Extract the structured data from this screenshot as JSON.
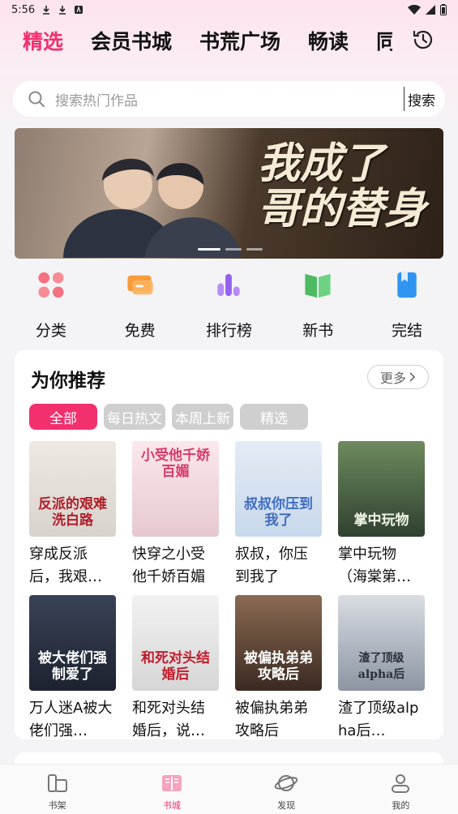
{
  "status_bar": {
    "time": "5:56"
  },
  "tabs": [
    {
      "label": "精选",
      "active": true
    },
    {
      "label": "会员书城"
    },
    {
      "label": "书荒广场"
    },
    {
      "label": "畅读"
    },
    {
      "label": "同"
    }
  ],
  "search": {
    "placeholder": "搜索热门作品",
    "button": "搜索"
  },
  "banner": {
    "title_line1": "我成了",
    "title_line2": "哥的替身"
  },
  "categories": [
    {
      "label": "分类",
      "icon": "clover-icon",
      "color": "#f4727f"
    },
    {
      "label": "免费",
      "icon": "ticket-icon",
      "color": "#f99b3c"
    },
    {
      "label": "排行榜",
      "icon": "bar-chart-icon",
      "color": "#a070f0"
    },
    {
      "label": "新书",
      "icon": "open-book-icon",
      "color": "#4cbb62"
    },
    {
      "label": "完结",
      "icon": "bookmark-icon",
      "color": "#2f95f0"
    }
  ],
  "recommend": {
    "heading": "为你推荐",
    "more": "更多",
    "chips": [
      "全部",
      "每日热文",
      "本周上新",
      "精选"
    ],
    "books": [
      {
        "title": "穿成反派后，我艰…",
        "cover_text": "反派的艰难洗白路"
      },
      {
        "title": "快穿之小受他千娇百媚",
        "cover_text": "小受他千娇百媚"
      },
      {
        "title": "叔叔，你压到我了",
        "cover_text": "叔叔你压到我了"
      },
      {
        "title": "掌中玩物（海棠第…",
        "cover_text": "掌中玩物"
      },
      {
        "title": "万人迷A被大佬们强…",
        "cover_text": "被大佬们强制爱了"
      },
      {
        "title": "和死对头结婚后，说…",
        "cover_text": "和死对头结婚后"
      },
      {
        "title": "被偏执弟弟攻略后",
        "cover_text": "被偏执弟弟攻略后"
      },
      {
        "title": "渣了顶级alpha后…",
        "cover_text": "渣了顶级alpha后"
      }
    ]
  },
  "bottom_nav": [
    {
      "label": "书架",
      "icon": "bookshelf-icon"
    },
    {
      "label": "书城",
      "icon": "bookstore-icon",
      "active": true
    },
    {
      "label": "发现",
      "icon": "planet-icon"
    },
    {
      "label": "我的",
      "icon": "profile-icon"
    }
  ]
}
